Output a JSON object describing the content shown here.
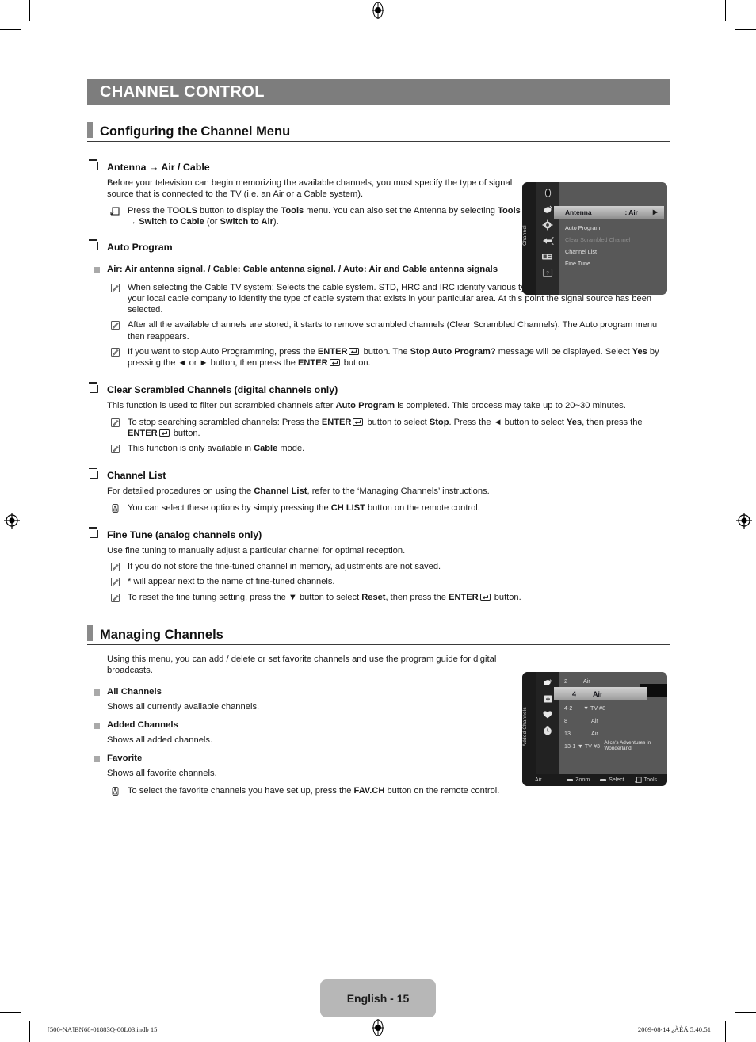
{
  "chapter": {
    "title": "CHANNEL CONTROL"
  },
  "sections": [
    {
      "id": "configuring",
      "title": "Configuring the Channel Menu"
    },
    {
      "id": "managing",
      "title": "Managing Channels"
    }
  ],
  "topics": {
    "antenna": {
      "heading": "Antenna → Air / Cable",
      "body": "Before your television can begin memorizing the available channels, you must specify the type of signal source that is connected to the TV (i.e. an Air or a Cable system).",
      "note_tools": "Press the TOOLS button to display the Tools menu. You can also set the Antenna by selecting Tools → Switch to Cable (or Switch to Air)."
    },
    "auto_program": {
      "heading": "Auto Program",
      "bullet": "Air: Air antenna signal. / Cable: Cable antenna signal. / Auto: Air and Cable antenna signals",
      "notes": [
        "When selecting the Cable TV system: Selects the cable system. STD, HRC and IRC identify various types of cable TV systems. Contact your local cable company to identify the type of cable system that exists in your particular area. At this point the signal source has been selected.",
        "After all the available channels are stored, it starts to remove scrambled channels (Clear Scrambled Channels). The Auto program menu then reappears.",
        "If you want to stop Auto Programming, press the ENTER button. The Stop Auto Program? message will be displayed. Select Yes by pressing the ◄ or ► button, then press the ENTER button."
      ]
    },
    "clear_scrambled": {
      "heading": "Clear Scrambled Channels (digital channels only)",
      "body": "This function is used to filter out scrambled channels after Auto Program is completed. This process may take up to 20~30 minutes.",
      "notes": [
        "To stop searching scrambled channels: Press the ENTER button to select Stop. Press the ◄ button to select Yes, then press the ENTER button.",
        "This function is only available in Cable mode."
      ]
    },
    "channel_list": {
      "heading": "Channel List",
      "body": "For detailed procedures on using the Channel List, refer to the ‘Managing Channels’ instructions.",
      "note": "You can select these options by simply pressing the CH LIST button on the remote control."
    },
    "fine_tune": {
      "heading": "Fine Tune (analog channels only)",
      "body": "Use fine tuning to manually adjust a particular channel for optimal reception.",
      "notes": [
        "If you do not store the fine-tuned channel in memory, adjustments are not saved.",
        "* will appear next to the name of fine-tuned channels.",
        "To reset the fine tuning setting, press the ▼ button to select Reset, then press the ENTER button."
      ]
    },
    "managing": {
      "body": "Using this menu, you can add / delete or set favorite channels and use the program guide for digital broadcasts.",
      "items": [
        {
          "label": "All Channels",
          "desc": "Shows all currently available channels."
        },
        {
          "label": "Added Channels",
          "desc": "Shows all added channels."
        },
        {
          "label": "Favorite",
          "desc": "Shows all favorite channels."
        }
      ],
      "note": "To select the favorite channels you have set up, press the FAV.CH button on the remote control."
    }
  },
  "osd_channel_menu": {
    "rail_label": "Channel",
    "selected": {
      "label": "Antenna",
      "value": ": Air",
      "arrow": "▶"
    },
    "items": [
      {
        "label": "Auto Program",
        "dim": false
      },
      {
        "label": "Clear Scrambled Channel",
        "dim": true
      },
      {
        "label": "Channel List",
        "dim": false
      },
      {
        "label": "Fine Tune",
        "dim": false
      }
    ]
  },
  "osd_channel_list": {
    "rail_label": "Added Channels",
    "rows": [
      {
        "num": "2",
        "src": "Air",
        "name": ""
      },
      {
        "num": "4-2",
        "src": "▼ TV #8",
        "name": ""
      },
      {
        "num": "8",
        "src": "Air",
        "name": ""
      },
      {
        "num": "13",
        "src": "Air",
        "name": ""
      },
      {
        "num": "13-1",
        "src": "▼ TV #3",
        "name": "Alice's Adventures in Wonderland"
      }
    ],
    "selected": {
      "num": "4",
      "src": "Air"
    },
    "bottom": {
      "mode": "Air",
      "zoom": "Zoom",
      "select": "Select",
      "tools": "Tools"
    }
  },
  "footer": {
    "page_badge": "English - 15",
    "file_meta": "[500-NA]BN68-01883Q-00L03.indb   15",
    "date_meta": "2009-08-14   ¿ÀÈÄ 5:40:51"
  },
  "colors": {
    "banner_bg": "#7d7d7d",
    "badge_bg": "#b7b7b7",
    "bullet": "#a9a9a9",
    "osd_body": "#585858"
  }
}
